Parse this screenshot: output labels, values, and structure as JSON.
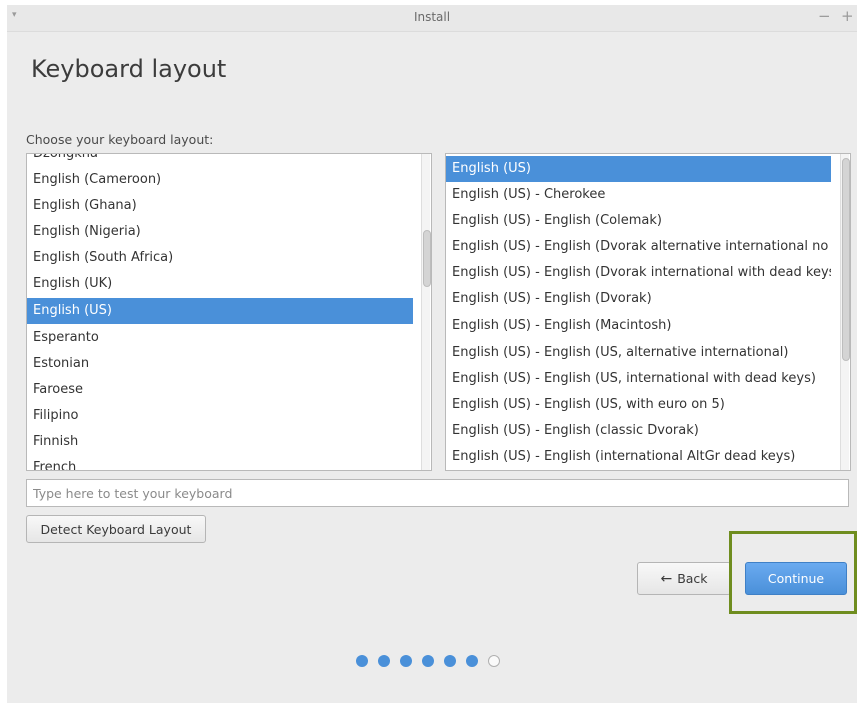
{
  "window": {
    "title": "Install",
    "menu_glyph": "▾",
    "minimize_glyph": "−",
    "maximize_glyph": "+"
  },
  "page": {
    "heading": "Keyboard layout",
    "prompt": "Choose your keyboard layout:"
  },
  "layouts": {
    "items": [
      "Dzongkha",
      "English (Cameroon)",
      "English (Ghana)",
      "English (Nigeria)",
      "English (South Africa)",
      "English (UK)",
      "English (US)",
      "Esperanto",
      "Estonian",
      "Faroese",
      "Filipino",
      "Finnish",
      "French"
    ],
    "selected": "English (US)"
  },
  "variants": {
    "items": [
      "English (US)",
      "English (US) - Cherokee",
      "English (US) - English (Colemak)",
      "English (US) - English (Dvorak alternative international no dead keys)",
      "English (US) - English (Dvorak international with dead keys)",
      "English (US) - English (Dvorak)",
      "English (US) - English (Macintosh)",
      "English (US) - English (US, alternative international)",
      "English (US) - English (US, international with dead keys)",
      "English (US) - English (US, with euro on 5)",
      "English (US) - English (classic Dvorak)",
      "English (US) - English (international AltGr dead keys)"
    ],
    "selected": "English (US)"
  },
  "test_input": {
    "placeholder": "Type here to test your keyboard",
    "value": ""
  },
  "buttons": {
    "detect": "Detect Keyboard Layout",
    "back": "Back",
    "back_icon": "←",
    "continue": "Continue"
  },
  "progress": {
    "current_step": 6,
    "total_steps": 7
  },
  "colors": {
    "accent": "#4a90d9",
    "highlight_box": "#6f8d1f"
  }
}
